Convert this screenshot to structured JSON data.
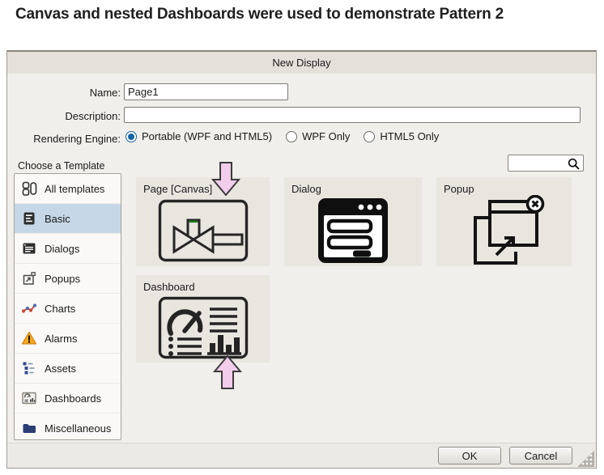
{
  "heading": "Canvas and nested Dashboards were used to demonstrate Pattern 2",
  "dialog": {
    "title": "New Display",
    "form": {
      "name_label": "Name:",
      "name_value": "Page1",
      "description_label": "Description:",
      "description_value": "",
      "rendering_engine_label": "Rendering Engine:",
      "rendering_options": [
        {
          "label": "Portable (WPF and HTML5)",
          "selected": true
        },
        {
          "label": "WPF Only",
          "selected": false
        },
        {
          "label": "HTML5 Only",
          "selected": false
        }
      ]
    },
    "search": {
      "value": "",
      "icon": "search-icon"
    },
    "choose_template_label": "Choose a Template",
    "sidebar": {
      "items": [
        {
          "label": "All templates",
          "icon": "all-templates-icon",
          "selected": false
        },
        {
          "label": "Basic",
          "icon": "basic-document-icon",
          "selected": true
        },
        {
          "label": "Dialogs",
          "icon": "dialogs-window-icon",
          "selected": false
        },
        {
          "label": "Popups",
          "icon": "popups-window-icon",
          "selected": false
        },
        {
          "label": "Charts",
          "icon": "charts-line-icon",
          "selected": false
        },
        {
          "label": "Alarms",
          "icon": "alarm-warning-icon",
          "selected": false
        },
        {
          "label": "Assets",
          "icon": "assets-tree-icon",
          "selected": false
        },
        {
          "label": "Dashboards",
          "icon": "dashboards-mini-icon",
          "selected": false
        },
        {
          "label": "Miscellaneous",
          "icon": "folder-icon",
          "selected": false
        }
      ]
    },
    "templates": [
      {
        "label": "Page [Canvas]",
        "icon": "page-canvas-valve-icon",
        "annotation": "pink-down-arrow"
      },
      {
        "label": "Dialog",
        "icon": "dialog-window-icon",
        "annotation": ""
      },
      {
        "label": "Popup",
        "icon": "popup-window-icon",
        "annotation": ""
      },
      {
        "label": "Dashboard",
        "icon": "dashboard-gauge-icon",
        "annotation": "pink-up-arrow"
      }
    ],
    "footer": {
      "ok_label": "OK",
      "cancel_label": "Cancel"
    },
    "colors": {
      "selected_item_bg": "#c6d8e8",
      "radio_accent": "#1464a5",
      "annotation_arrow_fill": "#f2cdec",
      "annotation_arrow_stroke": "#3c3c3c",
      "tile_bg": "#e9e6e0",
      "dialog_bg": "#f1efec",
      "titlebar_bg": "#e4e1da",
      "alarm_orange": "#f5a81c",
      "chart_red": "#cf4a3a",
      "chart_blue": "#4a6fb5",
      "folder_navy": "#2c3e74"
    }
  }
}
